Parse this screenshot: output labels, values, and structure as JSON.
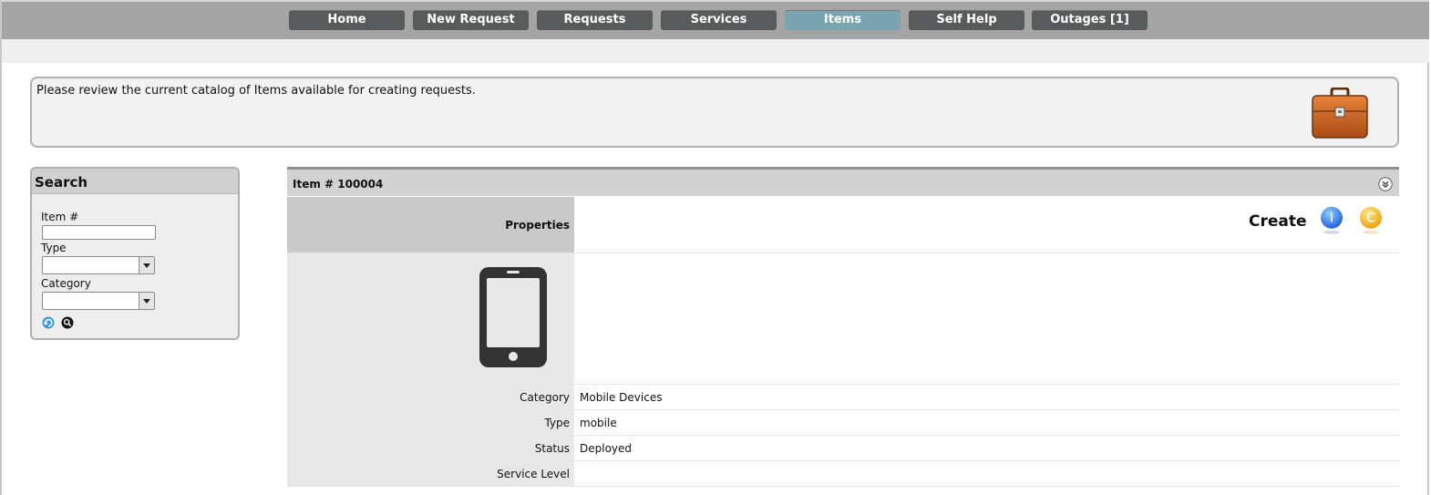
{
  "nav": {
    "items": [
      {
        "label": "Home",
        "active": false
      },
      {
        "label": "New Request",
        "active": false
      },
      {
        "label": "Requests",
        "active": false
      },
      {
        "label": "Services",
        "active": false
      },
      {
        "label": "Items",
        "active": true
      },
      {
        "label": "Self Help",
        "active": false
      },
      {
        "label": "Outages [1]",
        "active": false
      }
    ]
  },
  "banner": {
    "text": "Please review the current catalog of Items available for creating requests.",
    "icon": "briefcase-icon"
  },
  "search": {
    "title": "Search",
    "item_label": "Item #",
    "item_value": "",
    "type_label": "Type",
    "type_value": "",
    "category_label": "Category",
    "category_value": "",
    "reset_icon": "reset-icon",
    "search_icon": "magnifier-icon"
  },
  "item": {
    "title": "Item # 100004",
    "properties_label": "Properties",
    "create_label": "Create",
    "create_incident_letter": "I",
    "create_change_letter": "C",
    "image_icon": "smartphone-icon",
    "fields": [
      {
        "label": "Category",
        "value": "Mobile Devices"
      },
      {
        "label": "Type",
        "value": "mobile"
      },
      {
        "label": "Status",
        "value": "Deployed"
      },
      {
        "label": "Service Level",
        "value": ""
      }
    ]
  },
  "colors": {
    "nav_bg": "#585b5c",
    "nav_active": "#7aa4b2",
    "topbar": "#a4a4a4"
  }
}
